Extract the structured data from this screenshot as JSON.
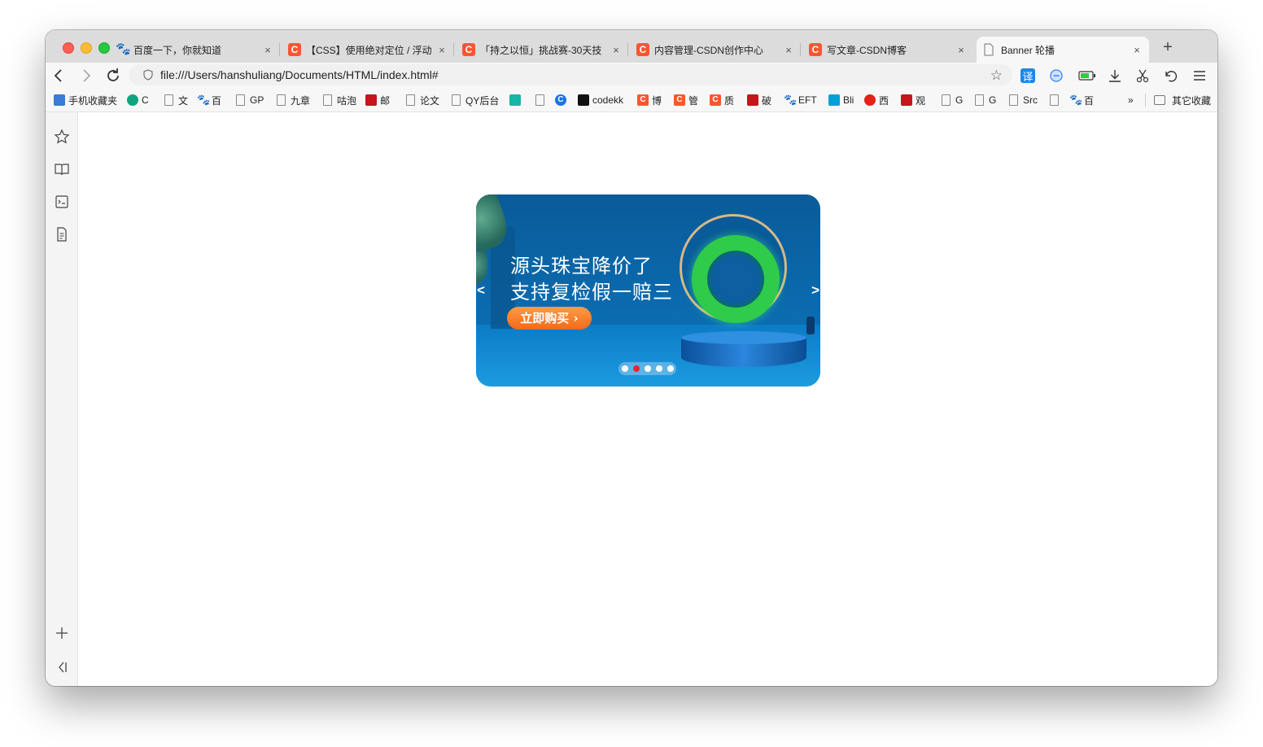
{
  "browser": {
    "tabs": [
      {
        "title": "百度一下，你就知道",
        "favicon": "baidu-paw-icon",
        "active": false
      },
      {
        "title": "【CSS】使用绝对定位 / 浮动",
        "favicon": "csdn-icon",
        "active": false
      },
      {
        "title": "「持之以恒」挑战赛-30天技",
        "favicon": "csdn-icon",
        "active": false
      },
      {
        "title": "内容管理-CSDN创作中心",
        "favicon": "csdn-icon",
        "active": false
      },
      {
        "title": "写文章-CSDN博客",
        "favicon": "csdn-icon",
        "active": false
      },
      {
        "title": "Banner 轮播",
        "favicon": "page-icon",
        "active": true
      }
    ],
    "close_glyph": "×",
    "new_tab_glyph": "+",
    "address": {
      "url": "file:///Users/hanshuliang/Documents/HTML/index.html#"
    },
    "ext_translate_label": "译",
    "bookmarks": [
      {
        "label": "手机收藏夹",
        "icon": "phone-icon"
      },
      {
        "label": "C",
        "icon": "chatgpt-icon"
      },
      {
        "label": "文",
        "icon": "page-icon"
      },
      {
        "label": "百",
        "icon": "baidu-paw-icon"
      },
      {
        "label": "GP",
        "icon": "page-icon"
      },
      {
        "label": "九章",
        "icon": "page-icon"
      },
      {
        "label": "咕泡",
        "icon": "page-icon"
      },
      {
        "label": "邮",
        "icon": "mail-icon"
      },
      {
        "label": "论文",
        "icon": "page-icon"
      },
      {
        "label": "QY后台",
        "icon": "page-icon"
      },
      {
        "label": "",
        "icon": "openai-icon"
      },
      {
        "label": "",
        "icon": "page-icon"
      },
      {
        "label": "",
        "icon": "c-logo-icon"
      },
      {
        "label": "codekk",
        "icon": "grid-icon"
      },
      {
        "label": "博",
        "icon": "csdn-icon"
      },
      {
        "label": "管",
        "icon": "csdn-icon"
      },
      {
        "label": "质",
        "icon": "csdn-icon"
      },
      {
        "label": "破",
        "icon": "red-stamp-icon"
      },
      {
        "label": "EFT",
        "icon": "baidu-paw-icon"
      },
      {
        "label": "Bli",
        "icon": "bilibili-icon"
      },
      {
        "label": "西",
        "icon": "play-circle-icon"
      },
      {
        "label": "观",
        "icon": "red-badge-icon"
      },
      {
        "label": "G",
        "icon": "page-icon"
      },
      {
        "label": "G",
        "icon": "page-icon"
      },
      {
        "label": "Src",
        "icon": "page-icon"
      },
      {
        "label": "",
        "icon": "page-icon"
      },
      {
        "label": "百",
        "icon": "baidu-paw-icon"
      }
    ],
    "bookmarks_more": "»",
    "other_bookmarks": "其它收藏"
  },
  "banner": {
    "headline_line1": "源头珠宝降价了",
    "headline_line2": "支持复检假一赔三",
    "cta_label": "立即购买 ›",
    "prev_label": "<",
    "next_label": ">",
    "slide_count": 5,
    "current_slide": 2
  },
  "colors": {
    "csdn_red": "#fc5531",
    "cta_orange": "#f26a1a",
    "active_dot": "#e8262a"
  }
}
